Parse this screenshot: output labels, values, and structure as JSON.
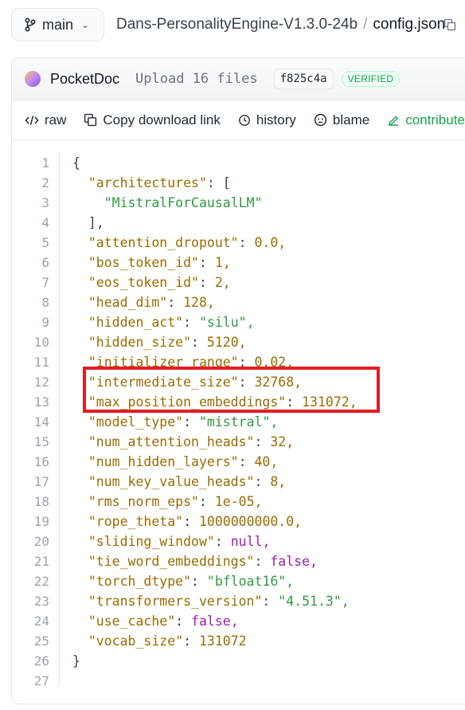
{
  "branch": {
    "label": "main"
  },
  "breadcrumb": {
    "repo": "Dans-PersonalityEngine-V1.3.0-24b",
    "separator": "/",
    "file": "config.json"
  },
  "commit": {
    "author": "PocketDoc",
    "message": "Upload 16 files",
    "sha": "f825c4a",
    "badge": "VERIFIED"
  },
  "toolbar": {
    "raw": "raw",
    "copy_download": "Copy download link",
    "history": "history",
    "blame": "blame",
    "contribute": "contribute"
  },
  "code_lines": [
    {
      "no": "1",
      "key": "",
      "val": "",
      "raw": "{"
    },
    {
      "no": "2",
      "key": "\"architectures\"",
      "val": "[",
      "type": "p"
    },
    {
      "no": "3",
      "key": "",
      "val": "\"MistralForCausalLM\"",
      "type": "s",
      "indent": 2
    },
    {
      "no": "4",
      "key": "",
      "val": "],",
      "type": "p",
      "indent": 1
    },
    {
      "no": "5",
      "key": "\"attention_dropout\"",
      "val": "0.0,",
      "type": "n"
    },
    {
      "no": "6",
      "key": "\"bos_token_id\"",
      "val": "1,",
      "type": "n"
    },
    {
      "no": "7",
      "key": "\"eos_token_id\"",
      "val": "2,",
      "type": "n"
    },
    {
      "no": "8",
      "key": "\"head_dim\"",
      "val": "128,",
      "type": "n"
    },
    {
      "no": "9",
      "key": "\"hidden_act\"",
      "val": "\"silu\",",
      "type": "s"
    },
    {
      "no": "10",
      "key": "\"hidden_size\"",
      "val": "5120,",
      "type": "n"
    },
    {
      "no": "11",
      "key": "\"initializer_range\"",
      "val": "0.02,",
      "type": "n"
    },
    {
      "no": "12",
      "key": "\"intermediate_size\"",
      "val": "32768,",
      "type": "n"
    },
    {
      "no": "13",
      "key": "\"max_position_embeddings\"",
      "val": "131072,",
      "type": "n"
    },
    {
      "no": "14",
      "key": "\"model_type\"",
      "val": "\"mistral\",",
      "type": "s"
    },
    {
      "no": "15",
      "key": "\"num_attention_heads\"",
      "val": "32,",
      "type": "n"
    },
    {
      "no": "16",
      "key": "\"num_hidden_layers\"",
      "val": "40,",
      "type": "n"
    },
    {
      "no": "17",
      "key": "\"num_key_value_heads\"",
      "val": "8,",
      "type": "n"
    },
    {
      "no": "18",
      "key": "\"rms_norm_eps\"",
      "val": "1e-05,",
      "type": "n"
    },
    {
      "no": "19",
      "key": "\"rope_theta\"",
      "val": "1000000000.0,",
      "type": "n"
    },
    {
      "no": "20",
      "key": "\"sliding_window\"",
      "val": "null,",
      "type": "kw"
    },
    {
      "no": "21",
      "key": "\"tie_word_embeddings\"",
      "val": "false,",
      "type": "kw"
    },
    {
      "no": "22",
      "key": "\"torch_dtype\"",
      "val": "\"bfloat16\",",
      "type": "s"
    },
    {
      "no": "23",
      "key": "\"transformers_version\"",
      "val": "\"4.51.3\",",
      "type": "s"
    },
    {
      "no": "24",
      "key": "\"use_cache\"",
      "val": "false,",
      "type": "kw"
    },
    {
      "no": "25",
      "key": "\"vocab_size\"",
      "val": "131072",
      "type": "n"
    },
    {
      "no": "26",
      "key": "",
      "val": "",
      "raw": "}"
    },
    {
      "no": "27",
      "key": "",
      "val": "",
      "raw": ""
    }
  ],
  "colors": {
    "accent_green": "#16a34a",
    "highlight_red": "#e11d24",
    "key_color": "#9a6b00",
    "string_color": "#2e9a3e",
    "keyword_color": "#a21caf"
  },
  "icons": [
    "branch-icon",
    "chevron-down-icon",
    "copy-icon",
    "code-icon",
    "history-icon",
    "blame-icon",
    "pencil-icon"
  ]
}
